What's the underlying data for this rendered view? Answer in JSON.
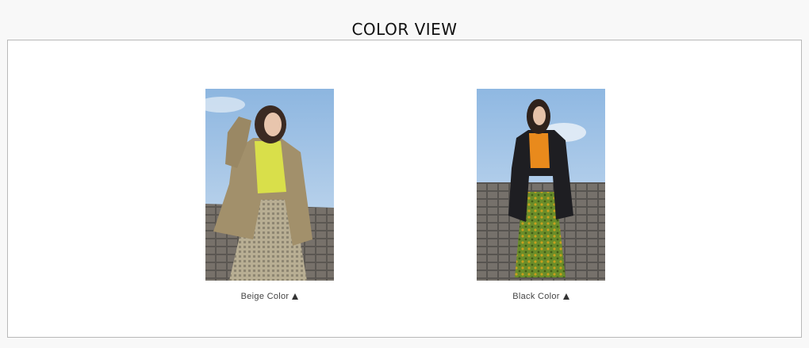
{
  "header": {
    "title": "COLOR VIEW"
  },
  "colors": {
    "sky": "#a9c8e8",
    "roof": "#5e5a56",
    "beige_jacket": "#a2906b",
    "lime_top": "#d9df4a",
    "black_jacket": "#1e1e22",
    "orange_top": "#e98a1c",
    "green_skirt": "#6a8d2a"
  },
  "variants": [
    {
      "label": "Beige Color",
      "icon": "triangle-up-icon"
    },
    {
      "label": "Black Color",
      "icon": "triangle-up-icon"
    }
  ]
}
